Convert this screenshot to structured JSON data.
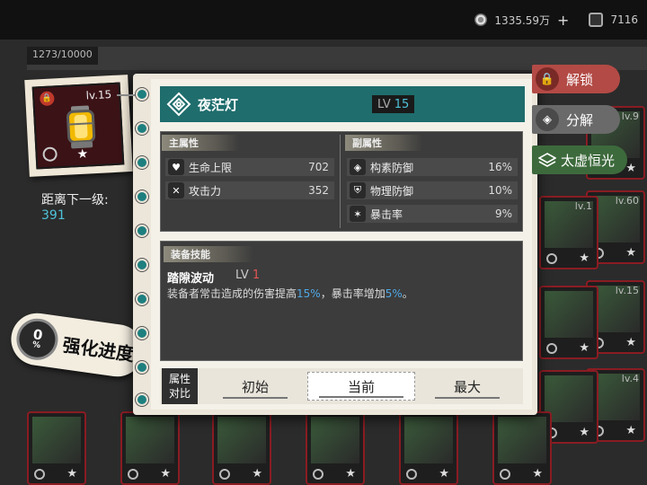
{
  "topbar": {
    "currency_value": "1335.59万",
    "currency_add": "+",
    "ticket_value": "7116"
  },
  "inventory": {
    "count_label": "1273/10000",
    "bg_levels": [
      "lv.9",
      "lv.60",
      "lv.15",
      "lv.4",
      "lv.1"
    ]
  },
  "item": {
    "level": "lv.15",
    "next_level_label": "距离下一级:",
    "next_level_value": "391",
    "enhance_percent": "0",
    "enhance_percent_sign": "%",
    "enhance_label": "强化进度"
  },
  "panel": {
    "name": "夜茫灯",
    "lv_prefix": "LV",
    "lv_value": "15",
    "main_attr_title": "主属性",
    "sub_attr_title": "副属性",
    "main_attrs": [
      {
        "name": "生命上限",
        "value": "702",
        "icon": "heart-icon"
      },
      {
        "name": "攻击力",
        "value": "352",
        "icon": "crossed-swords-icon"
      }
    ],
    "sub_attrs": [
      {
        "name": "构素防御",
        "value": "16%",
        "icon": "shield-gem-icon"
      },
      {
        "name": "物理防御",
        "value": "10%",
        "icon": "shield-icon"
      },
      {
        "name": "暴击率",
        "value": "9%",
        "icon": "crit-icon"
      }
    ],
    "skill_title": "装备技能",
    "skill_name": "踏隙波动",
    "skill_lv_prefix": "LV",
    "skill_lv_value": "1",
    "skill_desc_1": "装备者常击造成的伤害提高",
    "skill_desc_h1": "15%",
    "skill_desc_2": "，暴击率增加",
    "skill_desc_h2": "5%",
    "skill_desc_3": "。",
    "compare_label_1": "属性",
    "compare_label_2": "对比",
    "compare_options": [
      "初始",
      "当前",
      "最大"
    ],
    "compare_selected": "当前"
  },
  "actions": {
    "unlock": "解锁",
    "decompose": "分解",
    "taixu": "太虚恒光"
  },
  "colors": {
    "accent_teal": "#1f6d6d",
    "highlight_blue": "#4fa8e6",
    "unlock_red": "#b34a45",
    "taixu_green": "#3d6a3c"
  }
}
